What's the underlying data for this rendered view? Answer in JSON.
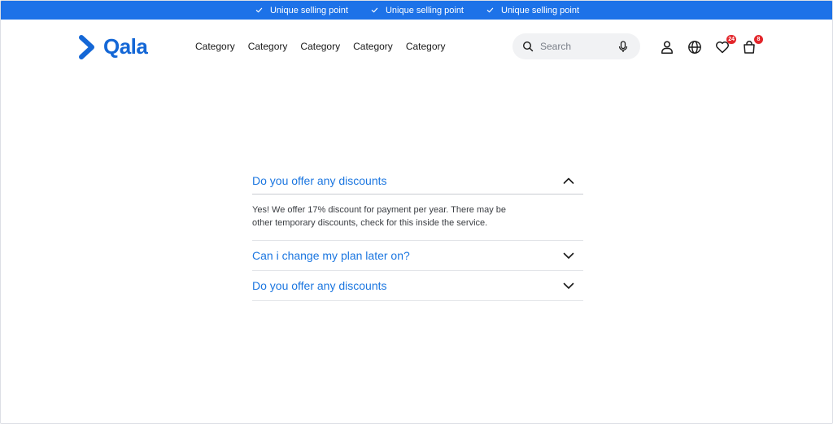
{
  "usp_bar": {
    "items": [
      "Unique selling point",
      "Unique selling point",
      "Unique selling point"
    ]
  },
  "header": {
    "logo_text": "Qala",
    "nav": [
      "Category",
      "Category",
      "Category",
      "Category",
      "Category"
    ],
    "search": {
      "placeholder": "Search"
    },
    "icons": [
      "user-icon",
      "globe-icon",
      "heart-icon",
      "bag-icon"
    ],
    "wishlist_count": "24",
    "cart_count": "8"
  },
  "colors": {
    "brand": "#1467d6",
    "usp_bar": "#1d72e8",
    "link": "#1b76e0",
    "badge": "#e3262b"
  },
  "faq": {
    "items": [
      {
        "question": "Do you offer any discounts",
        "answer": "Yes! We offer 17% discount for payment per year. There may be other temporary discounts, check for this inside the service.",
        "expanded": true
      },
      {
        "question": "Can i change my plan later on?",
        "answer": "",
        "expanded": false
      },
      {
        "question": "Do you offer any discounts",
        "answer": "",
        "expanded": false
      }
    ]
  }
}
